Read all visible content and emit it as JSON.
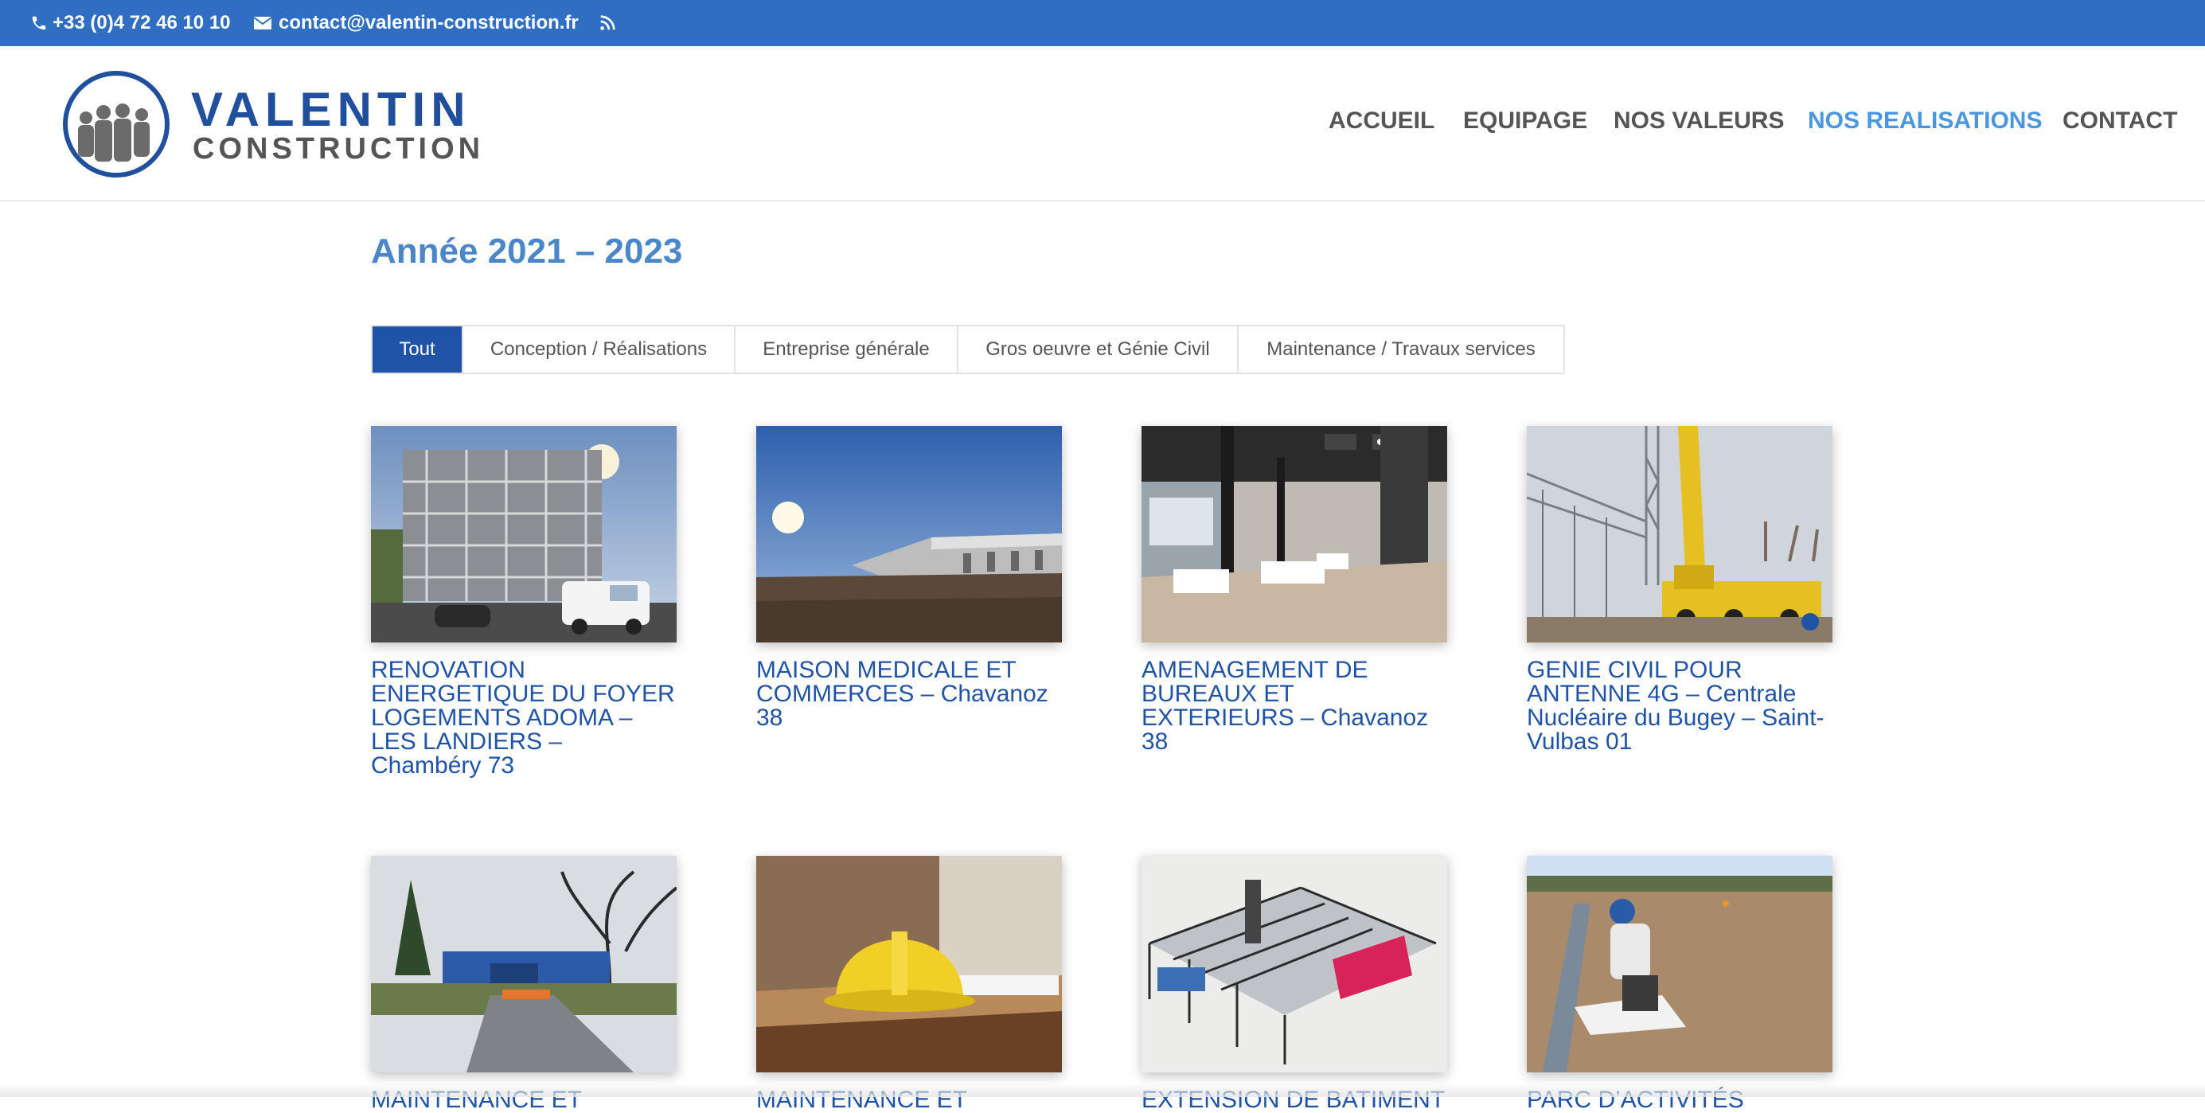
{
  "topbar": {
    "phone": "+33 (0)4 72 46 10 10",
    "email": "contact@valentin-construction.fr",
    "phone_icon": "phone-icon",
    "email_icon": "envelope-icon",
    "rss_icon": "rss-icon"
  },
  "logo": {
    "line1": "VALENTIN",
    "line2": "CONSTRUCTION"
  },
  "nav": {
    "items": [
      {
        "label": "ACCUEIL"
      },
      {
        "label": "EQUIPAGE"
      },
      {
        "label": "NOS VALEURS"
      },
      {
        "label": "NOS REALISATIONS",
        "active": true
      },
      {
        "label": "CONTACT"
      }
    ]
  },
  "main": {
    "title": "Année 2021 – 2023",
    "filters": [
      {
        "label": "Tout",
        "active": true
      },
      {
        "label": "Conception / Réalisations"
      },
      {
        "label": "Entreprise générale"
      },
      {
        "label": "Gros oeuvre et Génie Civil"
      },
      {
        "label": "Maintenance / Travaux services"
      }
    ],
    "projects": [
      {
        "title": "RENOVATION ENERGETIQUE DU FOYER LOGEMENTS ADOMA – LES LANDIERS – Chambéry 73"
      },
      {
        "title": "MAISON MEDICALE ET COMMERCES – Chavanoz 38"
      },
      {
        "title": "AMENAGEMENT DE BUREAUX ET EXTERIEURS – Chavanoz 38"
      },
      {
        "title": "GENIE CIVIL POUR ANTENNE 4G – Centrale Nucléaire du Bugey – Saint-Vulbas 01"
      },
      {
        "title": "MAINTENANCE ET"
      },
      {
        "title": "MAINTENANCE ET"
      },
      {
        "title": "EXTENSION DE BATIMENT"
      },
      {
        "title": "PARC D’ACTIVITÉS"
      }
    ]
  },
  "colors": {
    "topbar": "#2f6ec2",
    "brand_blue": "#1f4f9d",
    "nav_active": "#4a96e0",
    "title_blue": "#4a86c8",
    "link_blue": "#1f53a8"
  }
}
